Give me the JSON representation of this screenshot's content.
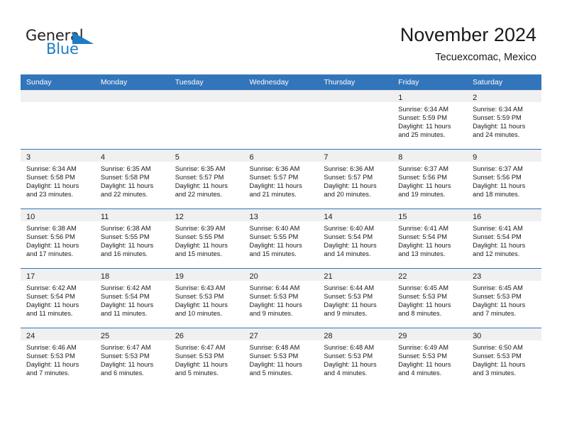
{
  "brand": {
    "word_one": "General",
    "word_two": "Blue",
    "mark": "triangle-logo-mark",
    "color_dark": "#231f20",
    "color_blue": "#1d7cc4"
  },
  "header": {
    "title": "November 2024",
    "subtitle": "Tecuexcomac, Mexico"
  },
  "theme": {
    "header_row_bg": "#3275bb",
    "cell_header_bg": "#f0f0f0",
    "row_divider": "#3275bb"
  },
  "weekday_headers": [
    "Sunday",
    "Monday",
    "Tuesday",
    "Wednesday",
    "Thursday",
    "Friday",
    "Saturday"
  ],
  "weeks": [
    [
      {
        "day": "",
        "lines": []
      },
      {
        "day": "",
        "lines": []
      },
      {
        "day": "",
        "lines": []
      },
      {
        "day": "",
        "lines": []
      },
      {
        "day": "",
        "lines": []
      },
      {
        "day": "1",
        "lines": [
          "Sunrise: 6:34 AM",
          "Sunset: 5:59 PM",
          "Daylight: 11 hours",
          "and 25 minutes."
        ]
      },
      {
        "day": "2",
        "lines": [
          "Sunrise: 6:34 AM",
          "Sunset: 5:59 PM",
          "Daylight: 11 hours",
          "and 24 minutes."
        ]
      }
    ],
    [
      {
        "day": "3",
        "lines": [
          "Sunrise: 6:34 AM",
          "Sunset: 5:58 PM",
          "Daylight: 11 hours",
          "and 23 minutes."
        ]
      },
      {
        "day": "4",
        "lines": [
          "Sunrise: 6:35 AM",
          "Sunset: 5:58 PM",
          "Daylight: 11 hours",
          "and 22 minutes."
        ]
      },
      {
        "day": "5",
        "lines": [
          "Sunrise: 6:35 AM",
          "Sunset: 5:57 PM",
          "Daylight: 11 hours",
          "and 22 minutes."
        ]
      },
      {
        "day": "6",
        "lines": [
          "Sunrise: 6:36 AM",
          "Sunset: 5:57 PM",
          "Daylight: 11 hours",
          "and 21 minutes."
        ]
      },
      {
        "day": "7",
        "lines": [
          "Sunrise: 6:36 AM",
          "Sunset: 5:57 PM",
          "Daylight: 11 hours",
          "and 20 minutes."
        ]
      },
      {
        "day": "8",
        "lines": [
          "Sunrise: 6:37 AM",
          "Sunset: 5:56 PM",
          "Daylight: 11 hours",
          "and 19 minutes."
        ]
      },
      {
        "day": "9",
        "lines": [
          "Sunrise: 6:37 AM",
          "Sunset: 5:56 PM",
          "Daylight: 11 hours",
          "and 18 minutes."
        ]
      }
    ],
    [
      {
        "day": "10",
        "lines": [
          "Sunrise: 6:38 AM",
          "Sunset: 5:56 PM",
          "Daylight: 11 hours",
          "and 17 minutes."
        ]
      },
      {
        "day": "11",
        "lines": [
          "Sunrise: 6:38 AM",
          "Sunset: 5:55 PM",
          "Daylight: 11 hours",
          "and 16 minutes."
        ]
      },
      {
        "day": "12",
        "lines": [
          "Sunrise: 6:39 AM",
          "Sunset: 5:55 PM",
          "Daylight: 11 hours",
          "and 15 minutes."
        ]
      },
      {
        "day": "13",
        "lines": [
          "Sunrise: 6:40 AM",
          "Sunset: 5:55 PM",
          "Daylight: 11 hours",
          "and 15 minutes."
        ]
      },
      {
        "day": "14",
        "lines": [
          "Sunrise: 6:40 AM",
          "Sunset: 5:54 PM",
          "Daylight: 11 hours",
          "and 14 minutes."
        ]
      },
      {
        "day": "15",
        "lines": [
          "Sunrise: 6:41 AM",
          "Sunset: 5:54 PM",
          "Daylight: 11 hours",
          "and 13 minutes."
        ]
      },
      {
        "day": "16",
        "lines": [
          "Sunrise: 6:41 AM",
          "Sunset: 5:54 PM",
          "Daylight: 11 hours",
          "and 12 minutes."
        ]
      }
    ],
    [
      {
        "day": "17",
        "lines": [
          "Sunrise: 6:42 AM",
          "Sunset: 5:54 PM",
          "Daylight: 11 hours",
          "and 11 minutes."
        ]
      },
      {
        "day": "18",
        "lines": [
          "Sunrise: 6:42 AM",
          "Sunset: 5:54 PM",
          "Daylight: 11 hours",
          "and 11 minutes."
        ]
      },
      {
        "day": "19",
        "lines": [
          "Sunrise: 6:43 AM",
          "Sunset: 5:53 PM",
          "Daylight: 11 hours",
          "and 10 minutes."
        ]
      },
      {
        "day": "20",
        "lines": [
          "Sunrise: 6:44 AM",
          "Sunset: 5:53 PM",
          "Daylight: 11 hours",
          "and 9 minutes."
        ]
      },
      {
        "day": "21",
        "lines": [
          "Sunrise: 6:44 AM",
          "Sunset: 5:53 PM",
          "Daylight: 11 hours",
          "and 9 minutes."
        ]
      },
      {
        "day": "22",
        "lines": [
          "Sunrise: 6:45 AM",
          "Sunset: 5:53 PM",
          "Daylight: 11 hours",
          "and 8 minutes."
        ]
      },
      {
        "day": "23",
        "lines": [
          "Sunrise: 6:45 AM",
          "Sunset: 5:53 PM",
          "Daylight: 11 hours",
          "and 7 minutes."
        ]
      }
    ],
    [
      {
        "day": "24",
        "lines": [
          "Sunrise: 6:46 AM",
          "Sunset: 5:53 PM",
          "Daylight: 11 hours",
          "and 7 minutes."
        ]
      },
      {
        "day": "25",
        "lines": [
          "Sunrise: 6:47 AM",
          "Sunset: 5:53 PM",
          "Daylight: 11 hours",
          "and 6 minutes."
        ]
      },
      {
        "day": "26",
        "lines": [
          "Sunrise: 6:47 AM",
          "Sunset: 5:53 PM",
          "Daylight: 11 hours",
          "and 5 minutes."
        ]
      },
      {
        "day": "27",
        "lines": [
          "Sunrise: 6:48 AM",
          "Sunset: 5:53 PM",
          "Daylight: 11 hours",
          "and 5 minutes."
        ]
      },
      {
        "day": "28",
        "lines": [
          "Sunrise: 6:48 AM",
          "Sunset: 5:53 PM",
          "Daylight: 11 hours",
          "and 4 minutes."
        ]
      },
      {
        "day": "29",
        "lines": [
          "Sunrise: 6:49 AM",
          "Sunset: 5:53 PM",
          "Daylight: 11 hours",
          "and 4 minutes."
        ]
      },
      {
        "day": "30",
        "lines": [
          "Sunrise: 6:50 AM",
          "Sunset: 5:53 PM",
          "Daylight: 11 hours",
          "and 3 minutes."
        ]
      }
    ]
  ]
}
